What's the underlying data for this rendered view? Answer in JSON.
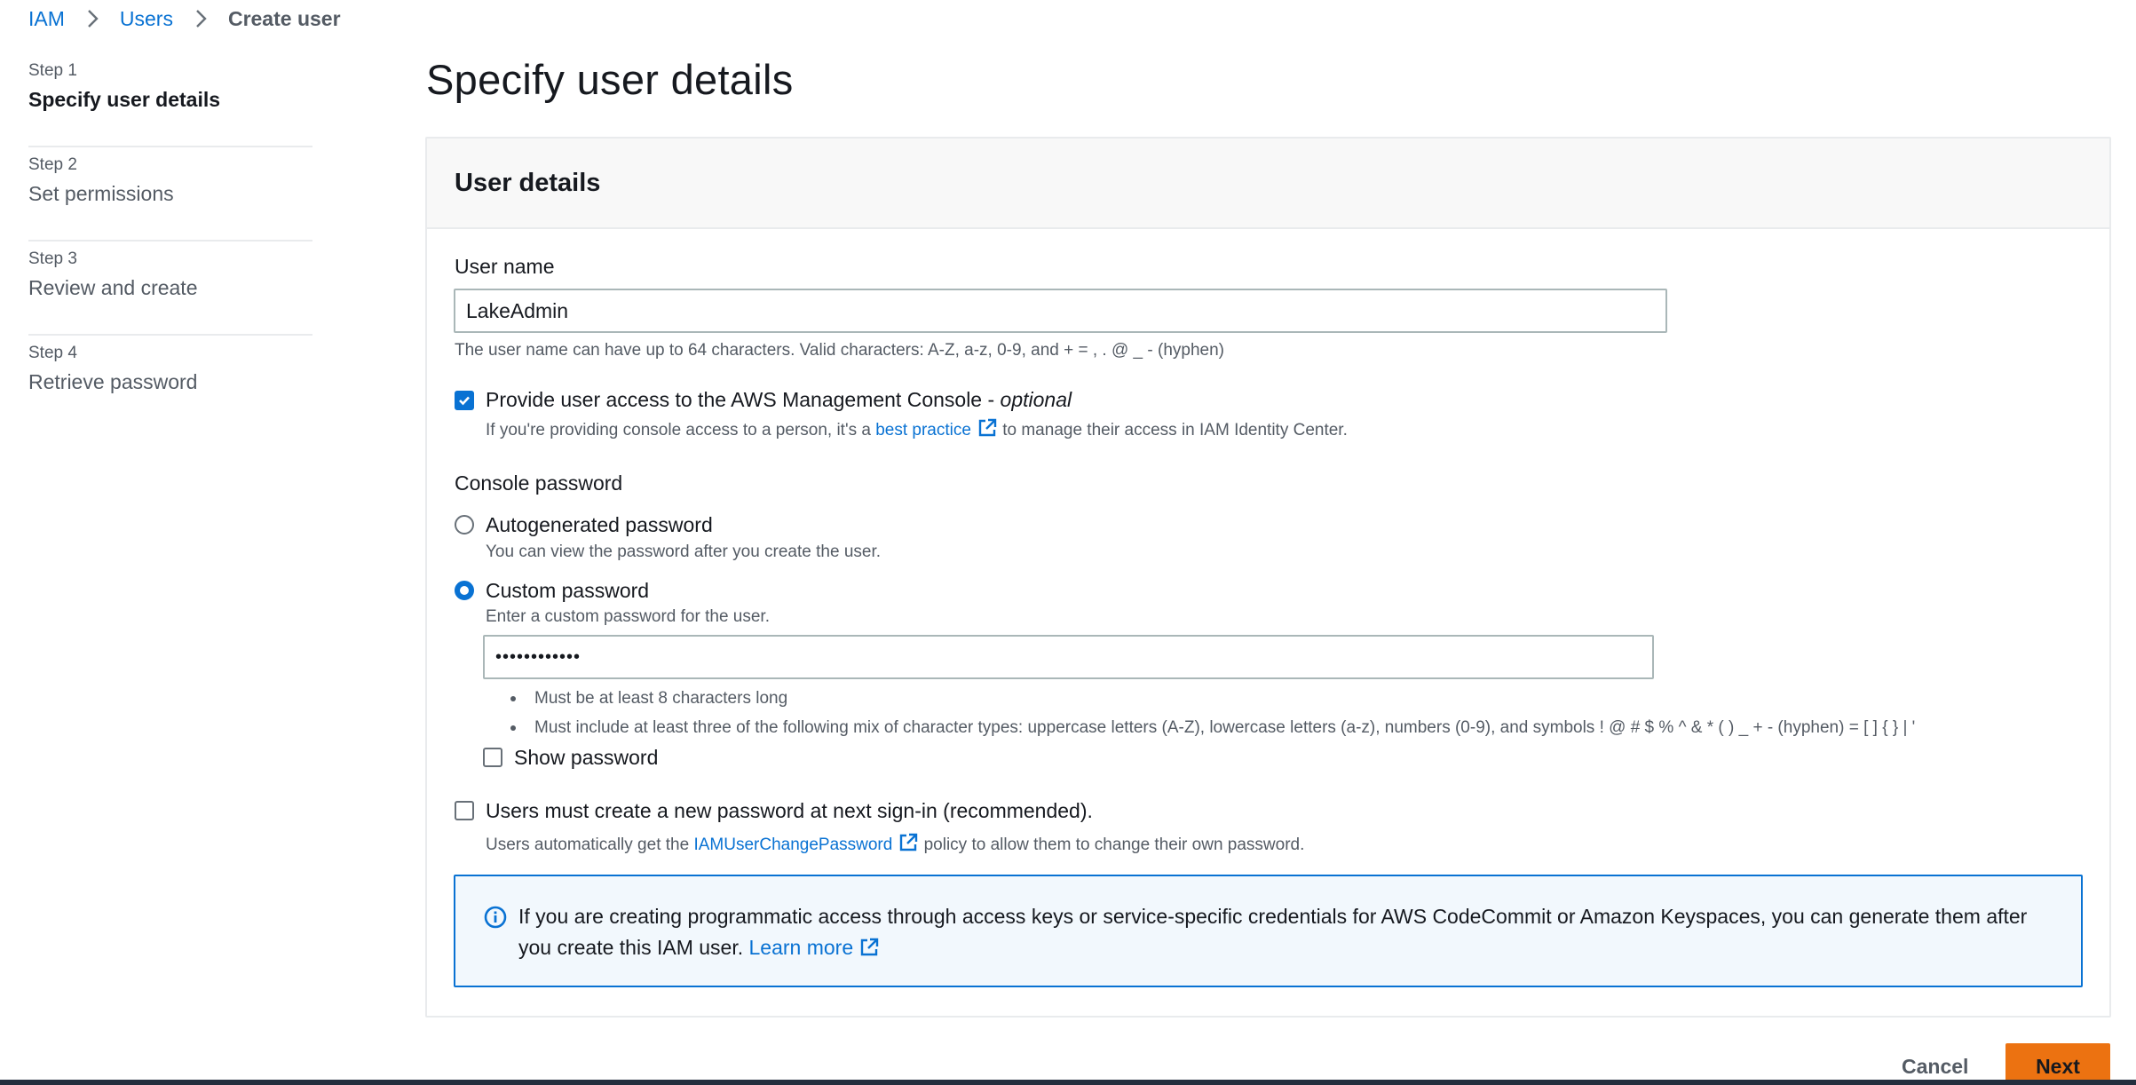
{
  "breadcrumb": {
    "items": [
      "IAM",
      "Users",
      "Create user"
    ]
  },
  "steps": [
    {
      "num": "Step 1",
      "title": "Specify user details",
      "active": true
    },
    {
      "num": "Step 2",
      "title": "Set permissions",
      "active": false
    },
    {
      "num": "Step 3",
      "title": "Review and create",
      "active": false
    },
    {
      "num": "Step 4",
      "title": "Retrieve password",
      "active": false
    }
  ],
  "page_title": "Specify user details",
  "panel": {
    "title": "User details",
    "username_label": "User name",
    "username_value": "LakeAdmin",
    "username_hint": "The user name can have up to 64 characters. Valid characters: A-Z, a-z, 0-9, and + = , . @ _ - (hyphen)",
    "console_access_label": "Provide user access to the AWS Management Console - ",
    "console_access_optional": "optional",
    "console_access_checked": true,
    "console_hint_prefix": "If you're providing console access to a person, it's a ",
    "console_hint_link": "best practice",
    "console_hint_suffix": " to manage their access in IAM Identity Center.",
    "console_password_label": "Console password",
    "autogen_label": "Autogenerated password",
    "autogen_hint": "You can view the password after you create the user.",
    "custom_label": "Custom password",
    "custom_hint": "Enter a custom password for the user.",
    "password_value": "••••••••••••",
    "rules": [
      "Must be at least 8 characters long",
      "Must include at least three of the following mix of character types: uppercase letters (A-Z), lowercase letters (a-z), numbers (0-9), and symbols ! @ # $ % ^ & * ( ) _ + - (hyphen) = [ ] { } | '"
    ],
    "show_password_label": "Show password",
    "reset_label": "Users must create a new password at next sign-in (recommended).",
    "reset_hint_prefix": "Users automatically get the ",
    "reset_hint_link": "IAMUserChangePassword",
    "reset_hint_suffix": " policy to allow them to change their own password.",
    "info_text": "If you are creating programmatic access through access keys or service-specific credentials for AWS CodeCommit or Amazon Keyspaces, you can generate them after you create this IAM user. ",
    "info_link": "Learn more"
  },
  "footer": {
    "cancel_label": "Cancel",
    "next_label": "Next"
  },
  "colors": {
    "accent": "#0972d3",
    "primary_button": "#ec7211",
    "info_background": "#f2f8fd"
  }
}
